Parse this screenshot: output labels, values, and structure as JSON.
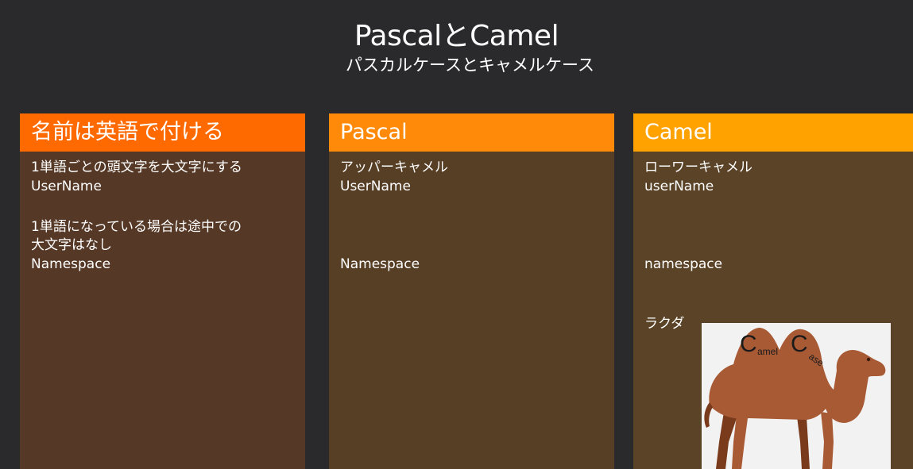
{
  "slide": {
    "title": "PascalとCamel",
    "subtitle": "パスカルケースとキャメルケース"
  },
  "columns": [
    {
      "header": "名前は英語で付ける",
      "lines": [
        "1単語ごとの頭文字を大文字にする",
        "UserName",
        "1単語になっている場合は途中での",
        "大文字はなし",
        "Namespace"
      ]
    },
    {
      "header": "Pascal",
      "lines": [
        "アッパーキャメル",
        "UserName",
        "Namespace"
      ]
    },
    {
      "header": "Camel",
      "lines": [
        "ローワーキャメル",
        "userName",
        "namespace",
        "ラクダ"
      ]
    }
  ],
  "camel_image": {
    "text_c1": "C",
    "text_amel": "amel",
    "text_c2": "C",
    "text_ase": "ase",
    "body_color": "#a85a35"
  }
}
